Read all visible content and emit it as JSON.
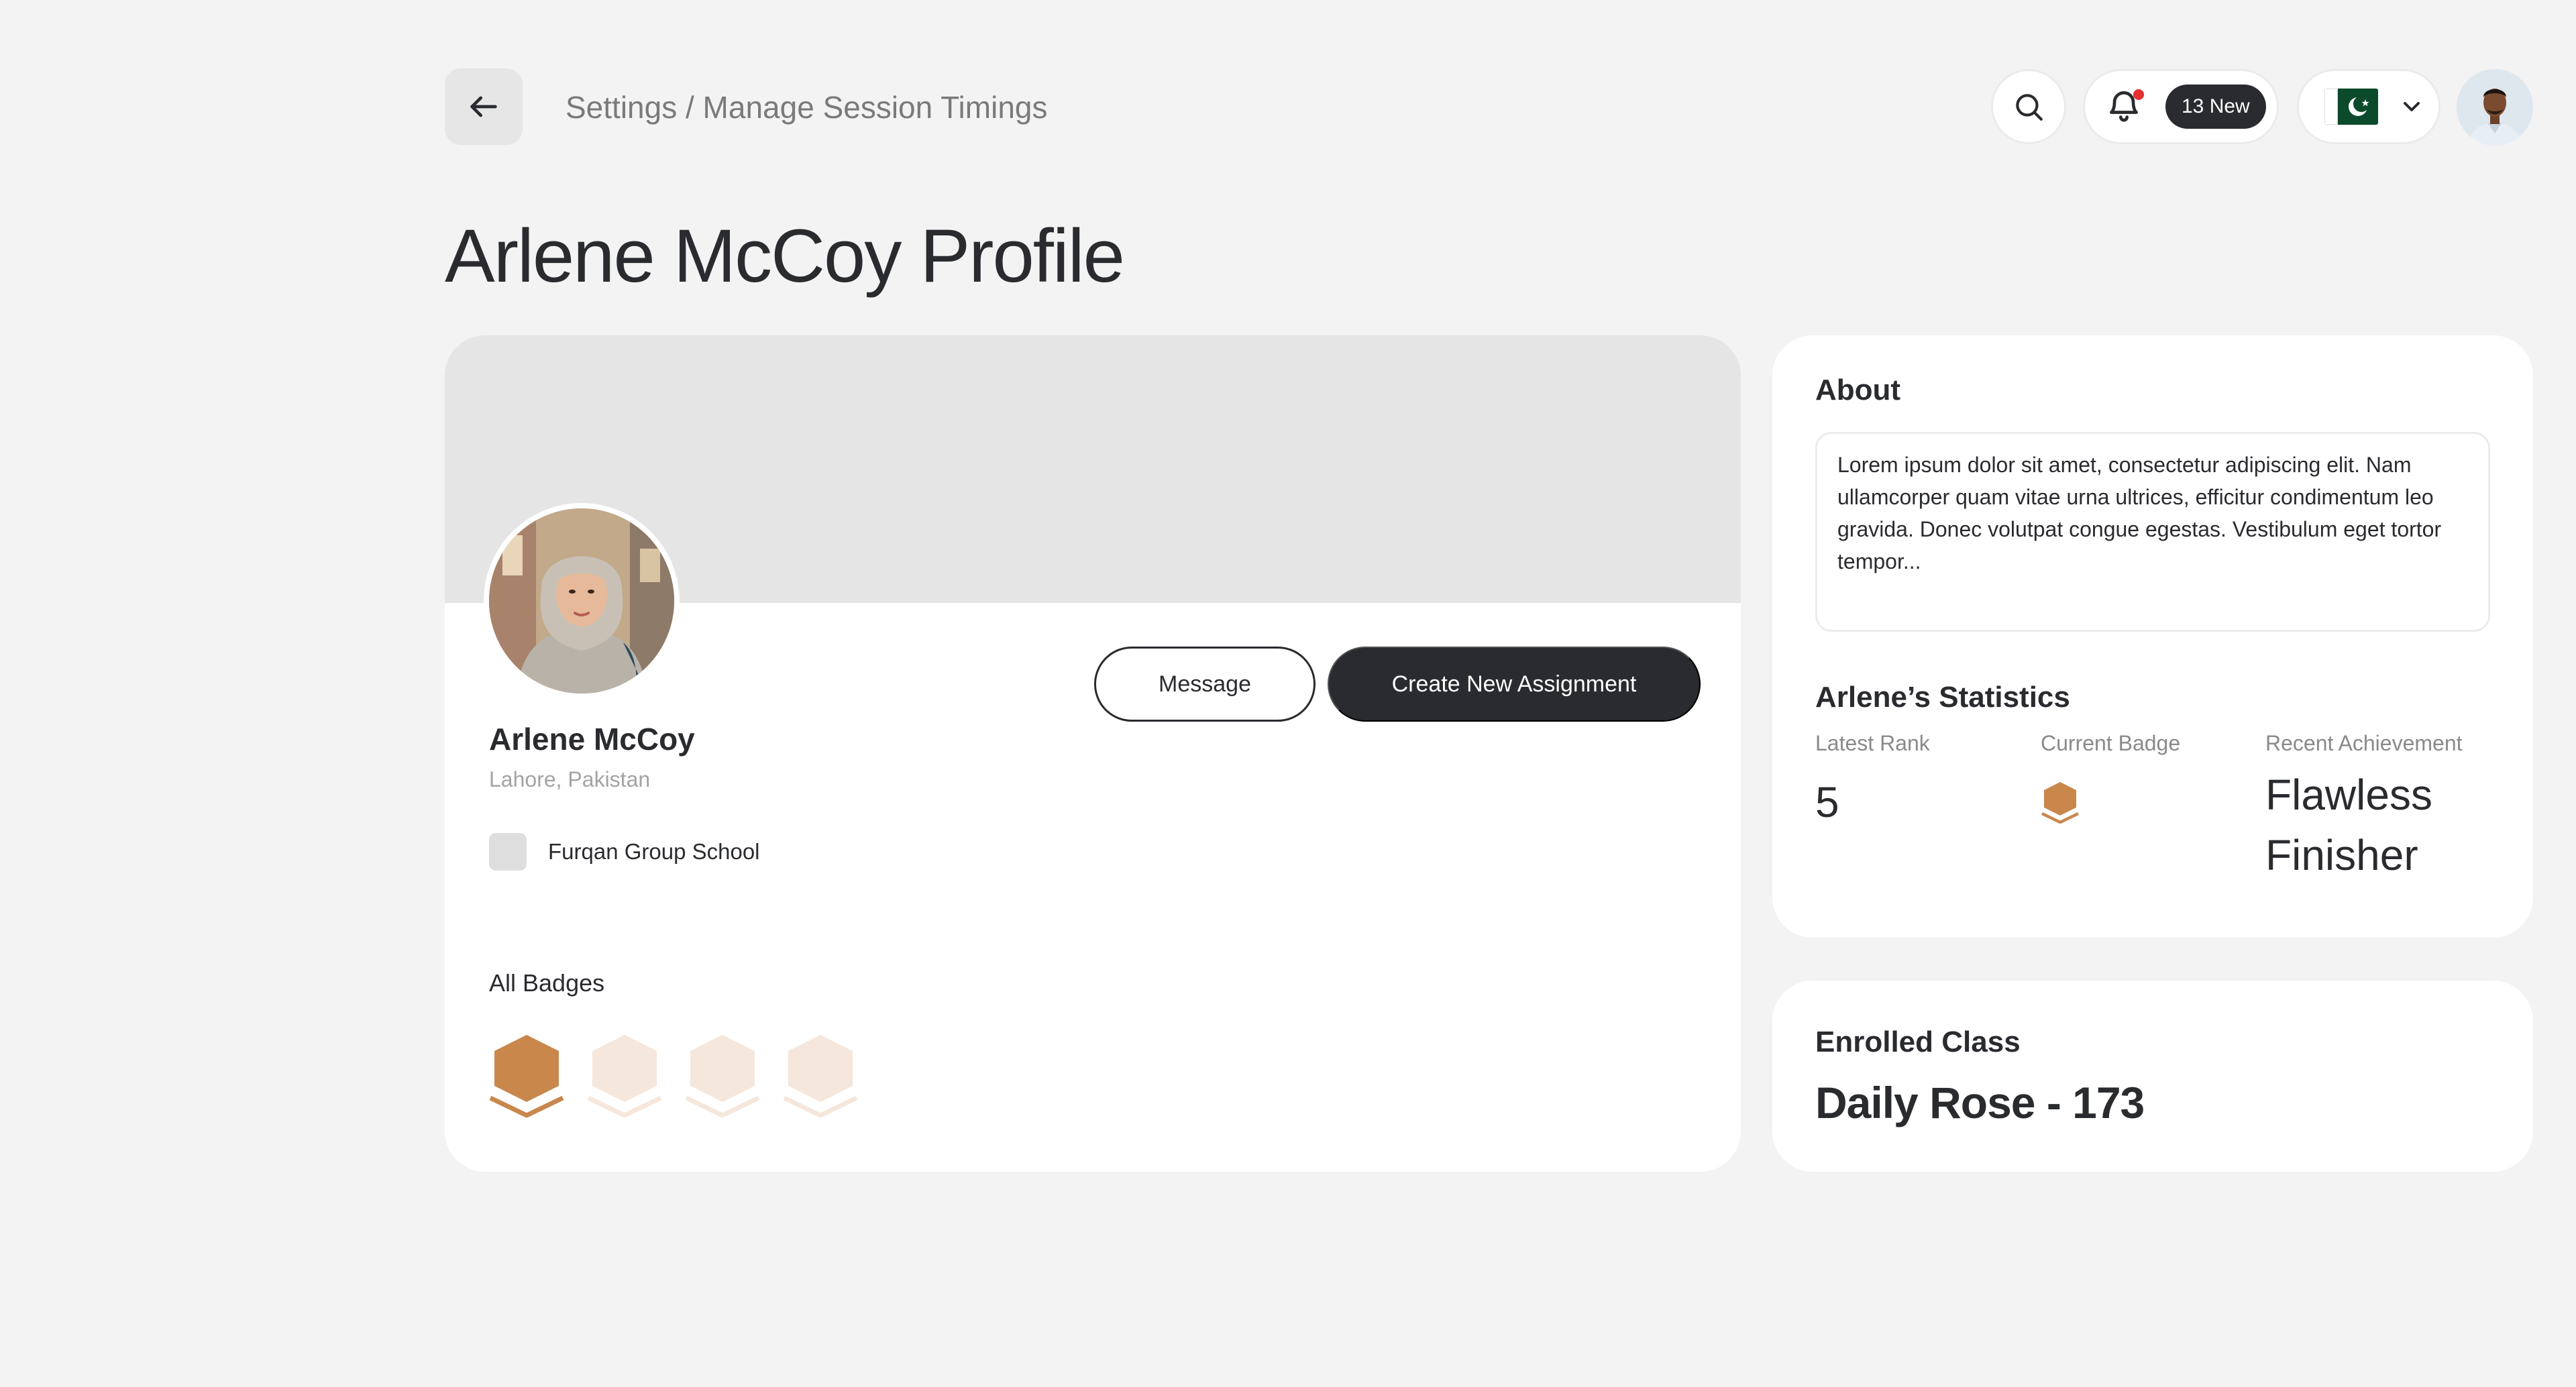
{
  "header": {
    "breadcrumb": "Settings / Manage Session Timings",
    "notifications_badge": "13 New",
    "language_flag": "pakistan-flag"
  },
  "page_title": "Arlene McCoy Profile",
  "profile": {
    "name": "Arlene McCoy",
    "location": "Lahore, Pakistan",
    "school": "Furqan Group School",
    "message_button": "Message",
    "create_assignment_button": "Create New Assignment",
    "badges_label": "All Badges",
    "badges_earned": 1,
    "badges_total": 4
  },
  "about": {
    "title": "About",
    "text": "Lorem ipsum dolor sit amet, consectetur adipiscing elit. Nam ullamcorper quam vitae urna ultrices, efficitur condimentum leo gravida. Donec volutpat congue egestas. Vestibulum eget tortor tempor..."
  },
  "statistics": {
    "title": "Arlene’s Statistics",
    "latest_rank_label": "Latest Rank",
    "latest_rank_value": "5",
    "current_badge_label": "Current Badge",
    "recent_achievement_label": "Recent Achievement",
    "recent_achievement_value": "Flawless Finisher"
  },
  "enrolled": {
    "title": "Enrolled Class",
    "value": "Daily Rose - 173"
  },
  "colors": {
    "badge_active": "#c9874c",
    "badge_inactive": "#f5e7dc",
    "dark": "#2a2b2f",
    "notification_dot": "#e5312f"
  }
}
